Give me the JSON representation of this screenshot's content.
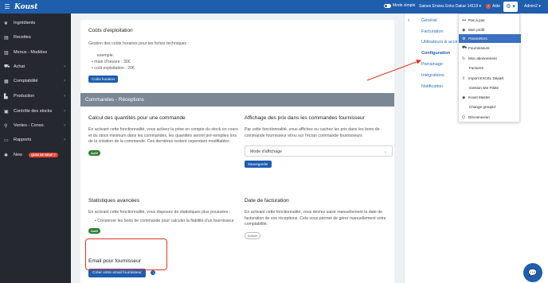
{
  "topbar": {
    "logo": "Koust",
    "mode_label": "Mode simple",
    "store": "Saines Envies Enko Dakar 14119 ▾",
    "help": "Aide",
    "gear": "⚙ ▾",
    "admin": "Admin2 ▾"
  },
  "sidebar": {
    "items": [
      {
        "label": "Ingrédients",
        "icon": "leaf-icon",
        "glyph": "❦"
      },
      {
        "label": "Recettes",
        "icon": "book-icon",
        "glyph": "▤"
      },
      {
        "label": "Menus - Modèles",
        "icon": "open-book-icon",
        "glyph": "▥"
      },
      {
        "label": "Achat",
        "icon": "truck-icon",
        "glyph": "⛟"
      },
      {
        "label": "Comptabilité",
        "icon": "calculator-icon",
        "glyph": "▦"
      },
      {
        "label": "Production",
        "icon": "factory-icon",
        "glyph": "▙"
      },
      {
        "label": "Contrôle des stocks",
        "icon": "clipboard-icon",
        "glyph": "▣"
      },
      {
        "label": "Ventes - Conso.",
        "icon": "chart-icon",
        "glyph": "⚲"
      },
      {
        "label": "Rapports",
        "icon": "folder-icon",
        "glyph": "▭"
      },
      {
        "label": "New",
        "icon": "star-icon",
        "glyph": "✱"
      }
    ],
    "new_badge": "QUOI DE NEUF ?"
  },
  "card1": {
    "title": "Coûts d'exploitation",
    "description": "Gestion des coûts horaires pour les fiches techniques :",
    "example_title": "exemple:",
    "example_line1": "main d'oeuvre : 30€",
    "example_line2": "coût exploitation : 20€",
    "button": "Coûts horaires"
  },
  "section_header": "Commandes - Réceptions",
  "calc": {
    "title": "Calcul des quantités pour une commande",
    "text": "En activant cette fonctionnalité, vous activez la prise en compte du stock en cours et du stock minimum dans les commandes, les quantités seront pré-remplies lors de la création de la commande. Ces dernières restent cependant modifiables",
    "badge": "Actif"
  },
  "prices": {
    "title": "Affichage des prix dans les commandes fournisseur",
    "text": "Par cette fonctionnalité, vous affichez ou cachez les prix dans les bons de commande fournisseur et/ou sur l'écran commande fournisseurs",
    "select": "Mode d'affichage",
    "button": "Sauvegarder"
  },
  "stats": {
    "title": "Statistiques avancées",
    "text": "En activant cette fonctionnalité, vous disposez de statistiques plus poussées :",
    "bullet": "Conserver les bons de commande pour calculer la fiabilité d'un fournisseur",
    "badge": "Actif"
  },
  "billing_date": {
    "title": "Date de facturation",
    "text": "En activant cette fonctionnalité, vous devrez saisir manuellement la date de facturation de vos réceptions. Cela vous permet de gérer manuellement votre comptabilité.",
    "badge": "Activer"
  },
  "email": {
    "title": "Email pour fournisseur",
    "button": "Créer votre email fournisseur",
    "info": "i"
  },
  "right_panel": {
    "chevron": "›",
    "links": [
      "Général",
      "Facturation",
      "Utilisateurs & accè",
      "Configuration",
      "Parrainage",
      "Intégrations",
      "Notification"
    ]
  },
  "dropdown": {
    "items": [
      {
        "label": "Pas à pas",
        "icon": "dots-icon",
        "glyph": "•••"
      },
      {
        "label": "Mon profil",
        "icon": "user-icon",
        "glyph": "👤"
      },
      {
        "label": "Paramètres",
        "icon": "gear-icon",
        "glyph": "⚙"
      },
      {
        "label": "Fournisseurs",
        "icon": "truck-icon",
        "glyph": "⛟"
      },
      {
        "label": "Mon abonnement",
        "icon": "refresh-icon",
        "glyph": "↻"
      },
      {
        "label": "Factures",
        "icon": "",
        "glyph": ""
      },
      {
        "label": "Import EXCEL Départ",
        "icon": "upload-icon",
        "glyph": "⇪"
      },
      {
        "label": "Gestion site Pilote",
        "icon": "",
        "glyph": ""
      },
      {
        "label": "Koust Master",
        "icon": "person-icon",
        "glyph": "👤"
      },
      {
        "label": "Change groupId",
        "icon": "",
        "glyph": ""
      },
      {
        "label": "Déconnexion",
        "icon": "power-icon",
        "glyph": "⏻"
      }
    ]
  },
  "chat_icon": "💬",
  "colors": {
    "primary": "#1f5dad",
    "sidebar": "#26282f",
    "highlight": "#e1331f",
    "active_green": "#2f7d32"
  }
}
